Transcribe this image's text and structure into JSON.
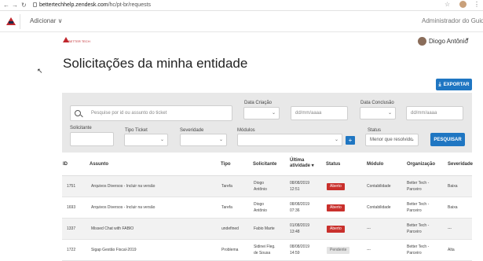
{
  "browser": {
    "url_host": "bettertechhelp.zendesk.com",
    "url_path": "/hc/pt-br/requests"
  },
  "header": {
    "add_label": "Adicionar ∨",
    "admin_label": "Administrador do Guid"
  },
  "user": {
    "name": "Diogo Antônio"
  },
  "brand": {
    "logo_text": "BETTER TECH"
  },
  "page": {
    "title": "Solicitações da minha entidade",
    "export_label": "EXPORTAR"
  },
  "filters": {
    "search_placeholder": "Pesquise por id ou assunto do ticket",
    "data_criacao_label": "Data Criação",
    "data_conclusao_label": "Data Conclusão",
    "date_placeholder": "dd/mm/aaaa",
    "solicitante_label": "Solicitante",
    "tipo_ticket_label": "Tipo Ticket",
    "severidade_label": "Severidade",
    "modulos_label": "Módulos",
    "status_label": "Status",
    "status_value": "Menor que resolvido",
    "search_button": "PESQUISAR",
    "plus_label": "+"
  },
  "table": {
    "headers": {
      "id": "ID",
      "assunto": "Assunto",
      "tipo": "Tipo",
      "solicitante": "Solicitante",
      "ultima_1": "Última",
      "ultima_2": "atividade ▾",
      "status": "Status",
      "modulo": "Módulo",
      "organizacao": "Organização",
      "severidade": "Severidade"
    },
    "rows": [
      {
        "id": "1751",
        "assunto": "Arquivos Diversos - Incluir na versão",
        "tipo": "Tarefa",
        "sol1": "Diogo",
        "sol2": "Antônio",
        "d1": "08/08/2019",
        "d2": "12:51",
        "status": "Aberto",
        "modulo": "Contabilidade",
        "org1": "Better Tech -",
        "org2": "Parceiro",
        "sev": "Baixa"
      },
      {
        "id": "1693",
        "assunto": "Arquivos Diversos - Incluir na versão",
        "tipo": "Tarefa",
        "sol1": "Diogo",
        "sol2": "Antônio",
        "d1": "08/08/2019",
        "d2": "07:36",
        "status": "Aberto",
        "modulo": "Contabilidade",
        "org1": "Better Tech -",
        "org2": "Parceiro",
        "sev": "Baixa"
      },
      {
        "id": "1337",
        "assunto": "Missed Chat with FABIO",
        "tipo": "undefined",
        "sol1": "Fabio Marte",
        "sol2": "",
        "d1": "01/08/2019",
        "d2": "13:48",
        "status": "Aberto",
        "modulo": "---",
        "org1": "Better Tech -",
        "org2": "Parceiro",
        "sev": "---"
      },
      {
        "id": "1722",
        "assunto": "Sigap Gestão Fiscal-2019",
        "tipo": "Problema",
        "sol1": "Sidinei Fleg.",
        "sol2": "de Sousa",
        "d1": "08/08/2019",
        "d2": "14:59",
        "status": "Pendente",
        "modulo": "---",
        "org1": "Better Tech -",
        "org2": "Parceiro",
        "sev": "Alta"
      }
    ]
  },
  "colors": {
    "accent": "#1f76c2",
    "danger": "#c9302c",
    "brand_red": "#c0272d"
  }
}
